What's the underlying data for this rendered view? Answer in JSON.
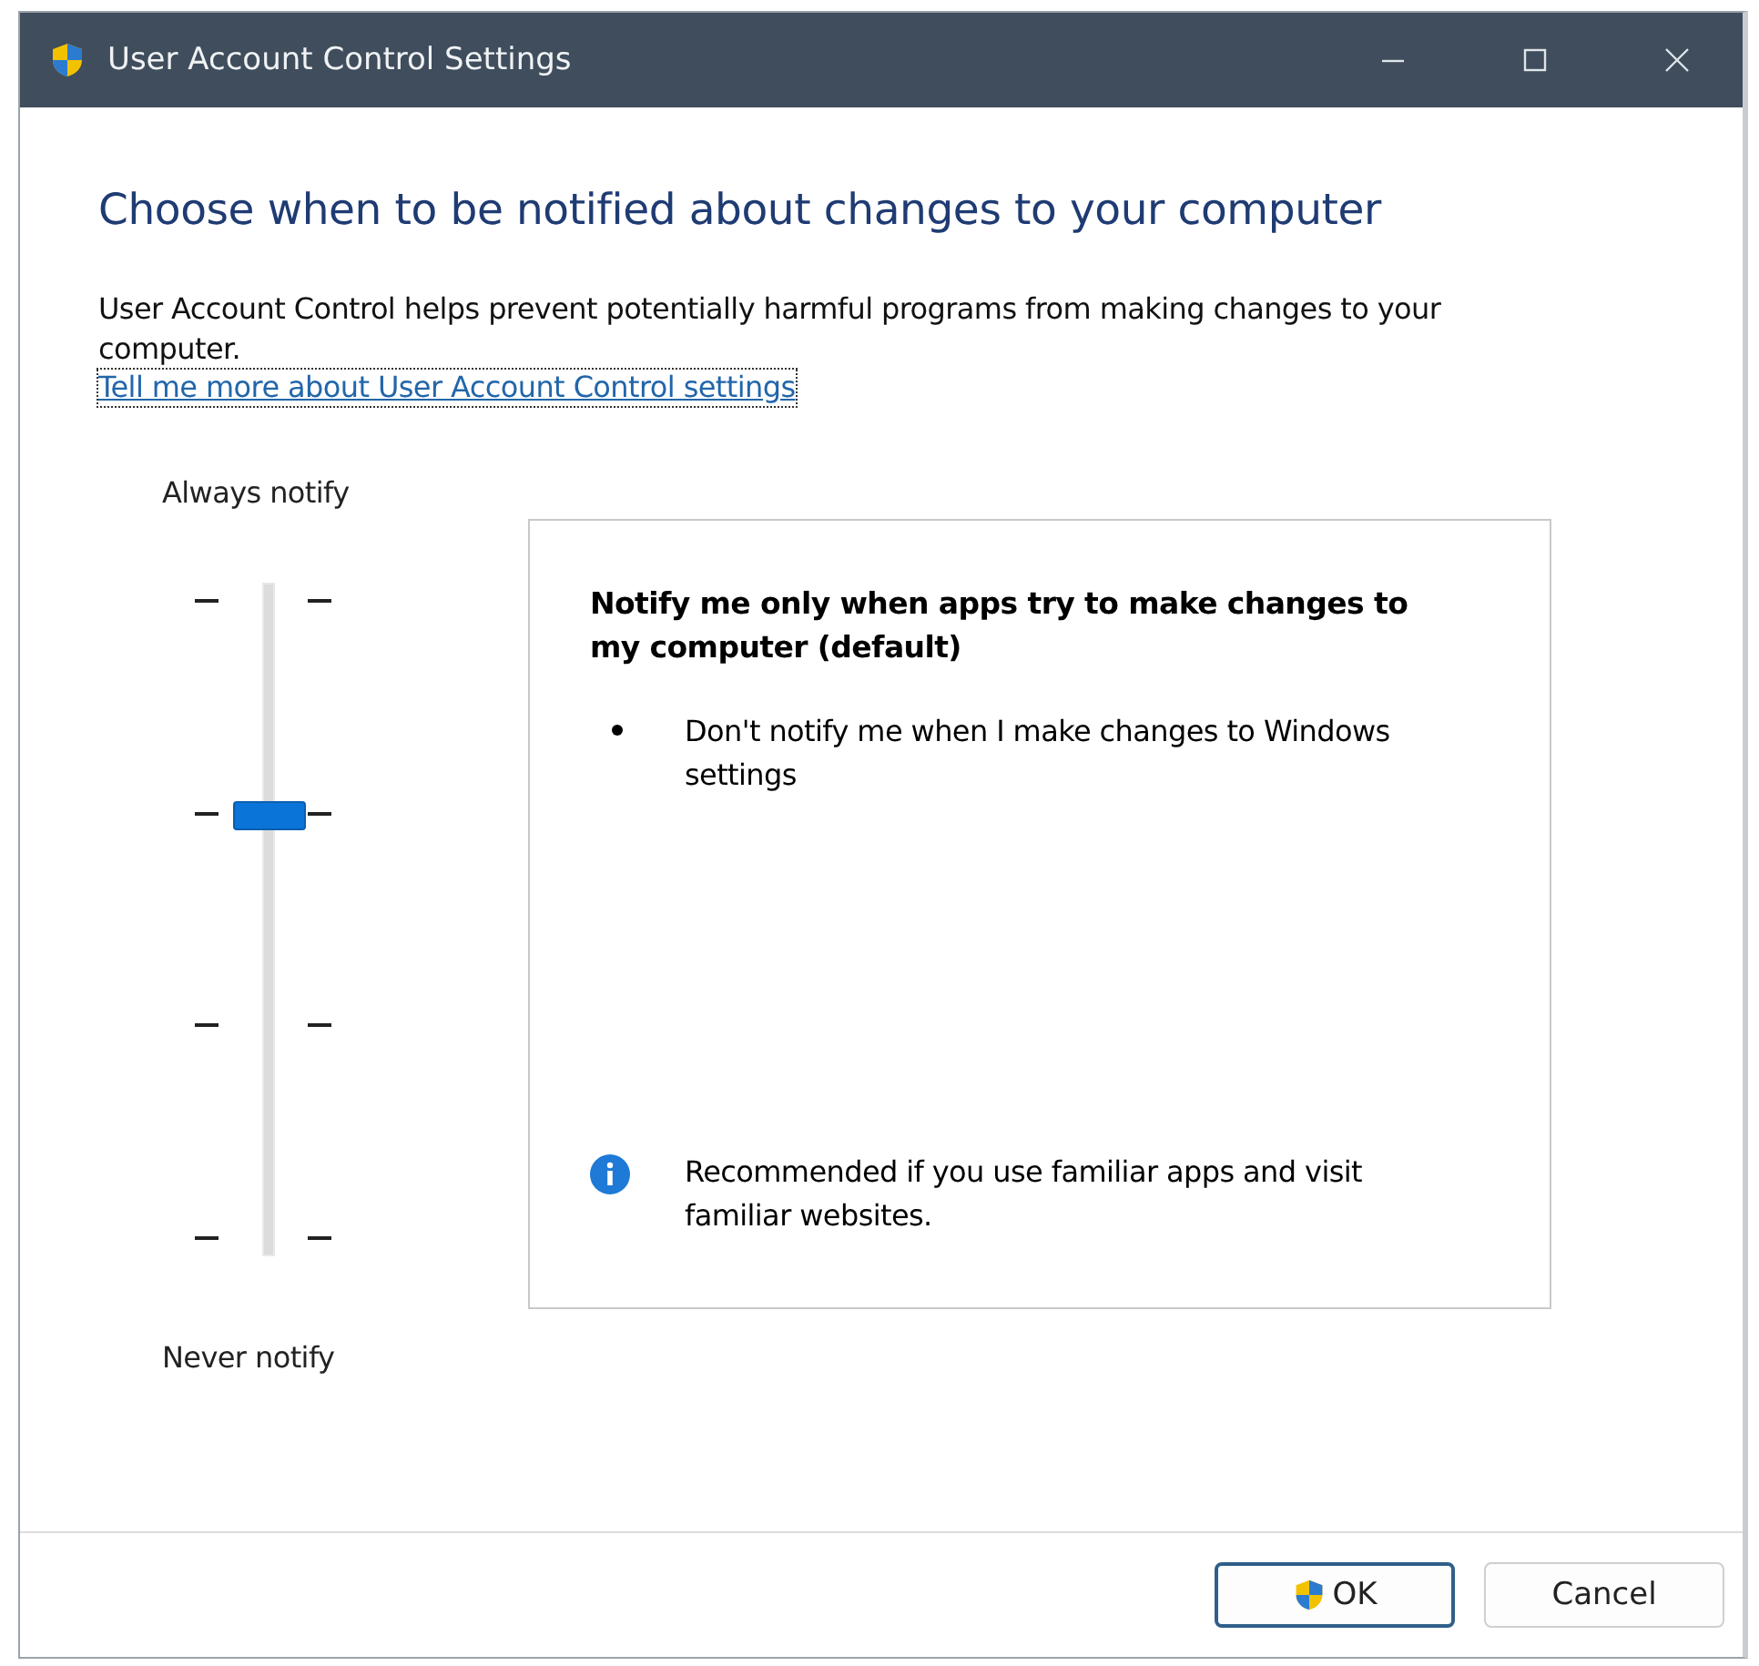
{
  "window": {
    "title": "User Account Control Settings"
  },
  "heading": "Choose when to be notified about changes to your computer",
  "description": "User Account Control helps prevent potentially harmful programs from making changes to your computer.",
  "link": "Tell me more about User Account Control settings",
  "slider": {
    "top_label": "Always notify",
    "bottom_label": "Never notify",
    "level": 0.6667
  },
  "panel": {
    "title": "Notify me only when apps try to make changes to my computer (default)",
    "bullets": [
      "Don't notify me when I make changes to Windows settings"
    ],
    "recommendation": "Recommended if you use familiar apps and visit familiar websites."
  },
  "buttons": [
    {
      "label": "OK",
      "kind": "shield"
    },
    {
      "label": "Cancel",
      "kind": "plain"
    }
  ]
}
